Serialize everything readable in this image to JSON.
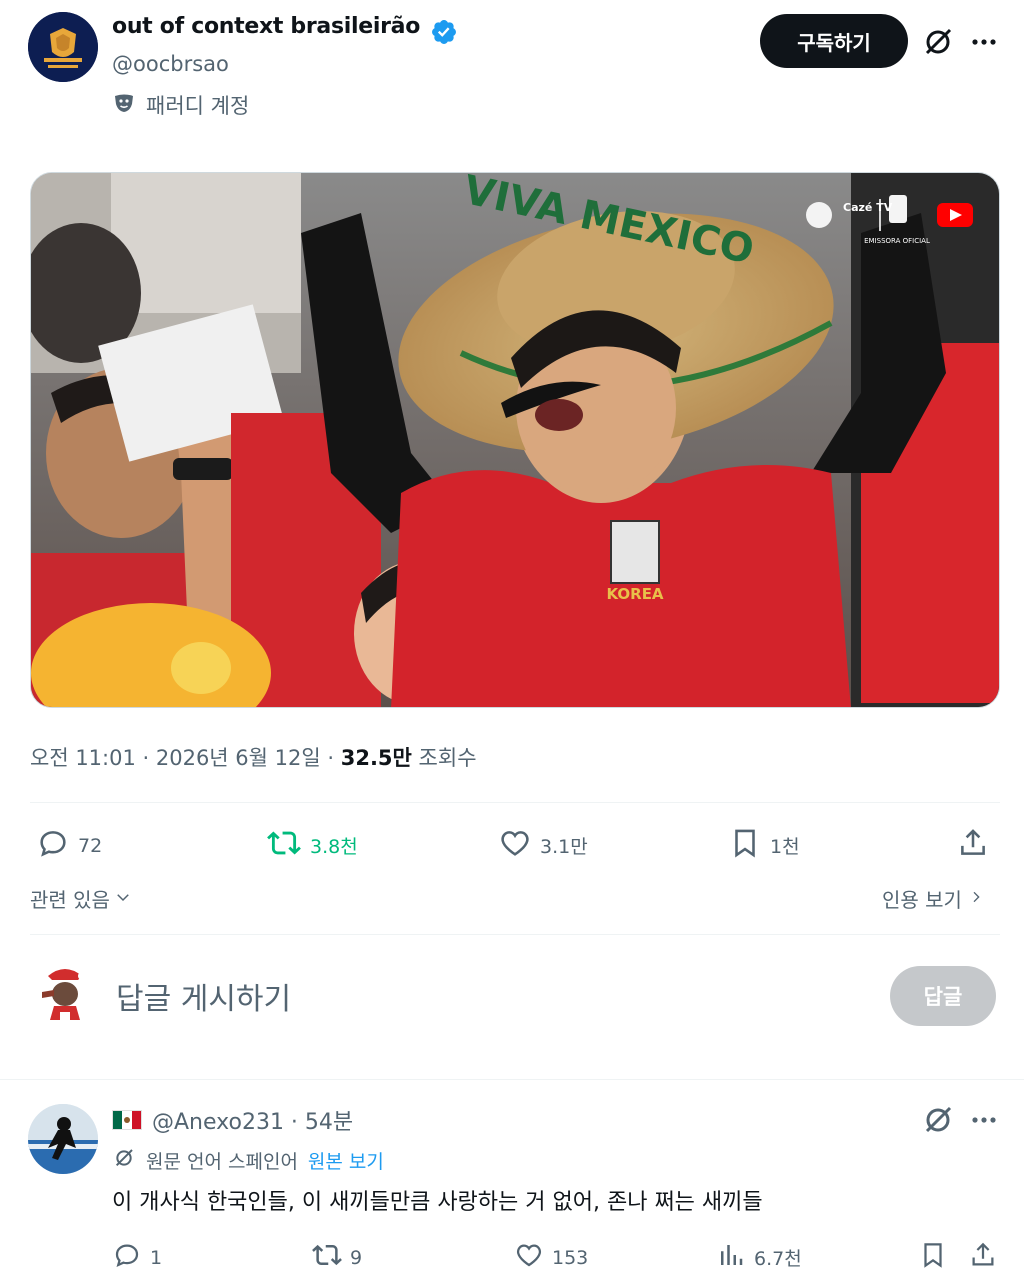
{
  "tweet": {
    "display_name": "out of context brasileirão",
    "handle": "@oocbrsao",
    "account_label": "패러디 계정",
    "subscribe_label": "구독하기",
    "meta_time": "오전 11:01 · 2026년 6월 12일 · ",
    "meta_views": "32.5만",
    "meta_views_suffix": " 조회수",
    "image_text_hat": "VIVA MEXICO",
    "image_text_jersey": "KOREA",
    "image_text_broadcaster": "Cazé TV",
    "image_text_emissora": "EMISSORA OFICIAL",
    "stats": {
      "replies": "72",
      "retweets": "3.8천",
      "likes": "3.1만",
      "bookmarks": "1천"
    },
    "related_label": "관련 있음",
    "quotes_label": "인용 보기"
  },
  "composer": {
    "placeholder": "답글 게시하기",
    "reply_button": "답글"
  },
  "comment": {
    "handle_time": "@Anexo231 · 54분",
    "translate_prefix": "원문 언어 스페인어",
    "translate_link": "원본 보기",
    "text": "이 개사식 한국인들, 이 새끼들만큼 사랑하는 거 없어, 존나 쩌는 새끼들",
    "stats": {
      "replies": "1",
      "retweets": "9",
      "likes": "153",
      "views": "6.7천"
    }
  },
  "colors": {
    "text": "#0f1419",
    "secondary": "#536471",
    "verified": "#1d9bf0",
    "retweet_active": "#00ba7c",
    "reply_button_disabled": "#c5c8cb"
  }
}
